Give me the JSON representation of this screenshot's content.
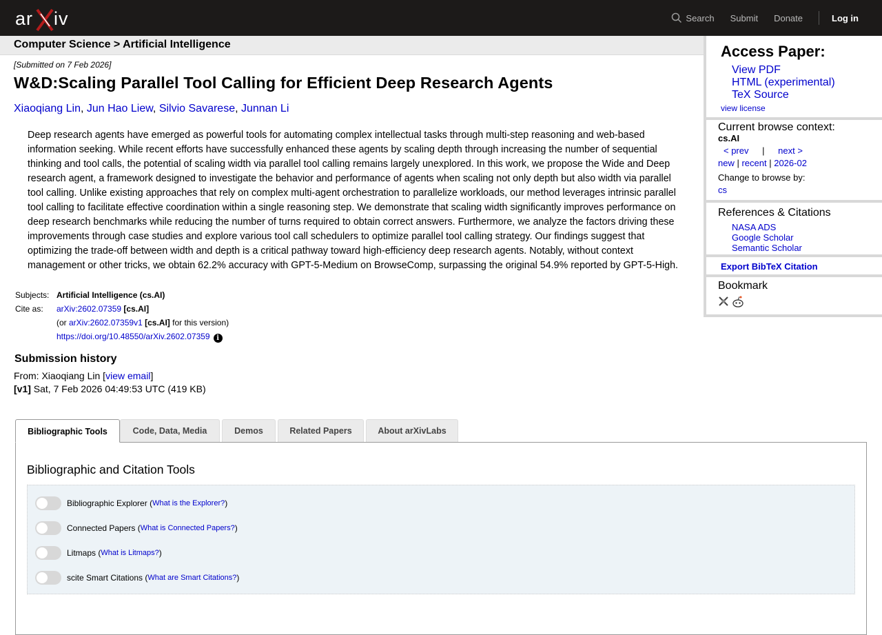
{
  "header": {
    "logo_text": "arXiv",
    "nav": {
      "search": "Search",
      "submit": "Submit",
      "donate": "Donate",
      "login": "Log in"
    },
    "colors": {
      "bg": "#1c1a19",
      "logo_x": "#b31b1b"
    }
  },
  "breadcrumb": "Computer Science > Artificial Intelligence",
  "paper": {
    "submitted": "[Submitted on 7 Feb 2026]",
    "title": "W&D:Scaling Parallel Tool Calling for Efficient Deep Research Agents",
    "authors": [
      "Xiaoqiang Lin",
      "Jun Hao Liew",
      "Silvio Savarese",
      "Junnan Li"
    ],
    "abstract": "Deep research agents have emerged as powerful tools for automating complex intellectual tasks through multi-step reasoning and web-based information seeking. While recent efforts have successfully enhanced these agents by scaling depth through increasing the number of sequential thinking and tool calls, the potential of scaling width via parallel tool calling remains largely unexplored. In this work, we propose the Wide and Deep research agent, a framework designed to investigate the behavior and performance of agents when scaling not only depth but also width via parallel tool calling. Unlike existing approaches that rely on complex multi-agent orchestration to parallelize workloads, our method leverages intrinsic parallel tool calling to facilitate effective coordination within a single reasoning step. We demonstrate that scaling width significantly improves performance on deep research benchmarks while reducing the number of turns required to obtain correct answers. Furthermore, we analyze the factors driving these improvements through case studies and explore various tool call schedulers to optimize parallel tool calling strategy. Our findings suggest that optimizing the trade-off between width and depth is a critical pathway toward high-efficiency deep research agents. Notably, without context management or other tricks, we obtain 62.2% accuracy with GPT-5-Medium on BrowseComp, surpassing the original 54.9% reported by GPT-5-High.",
    "subjects_label": "Subjects:",
    "subjects": "Artificial Intelligence (cs.AI)",
    "cite_label": "Cite as:",
    "cite_id": "arXiv:2602.07359",
    "cite_cat": "[cs.AI]",
    "cite_or": "(or ",
    "cite_v1": "arXiv:2602.07359v1",
    "cite_v1_cat": "[cs.AI]",
    "cite_suffix": " for this version)",
    "doi": "https://doi.org/10.48550/arXiv.2602.07359"
  },
  "history": {
    "heading": "Submission history",
    "from_prefix": "From: Xiaoqiang Lin [",
    "view_email": "view email",
    "from_suffix": "]",
    "version": "[v1]",
    "version_detail": " Sat, 7 Feb 2026 04:49:53 UTC (419 KB)"
  },
  "sidebar": {
    "access_heading": "Access Paper:",
    "access_links": [
      "View PDF",
      "HTML (experimental)",
      "TeX Source"
    ],
    "view_license": "view license",
    "context_heading": "Current browse context:",
    "context_cat": "cs.AI",
    "prev": "< prev",
    "divider": "|",
    "next": "next >",
    "new": "new",
    "recent": "recent",
    "month": "2026-02",
    "change_label": "Change to browse by:",
    "change_cat": "cs",
    "refs_heading": "References & Citations",
    "ref_links": [
      "NASA ADS",
      "Google Scholar",
      "Semantic Scholar"
    ],
    "bibtex": "Export BibTeX Citation",
    "bookmark_heading": "Bookmark",
    "bookmark_icons": [
      "bibsonomy-icon",
      "reddit-icon"
    ]
  },
  "tabs": [
    "Bibliographic Tools",
    "Code, Data, Media",
    "Demos",
    "Related Papers",
    "About arXivLabs"
  ],
  "tools": {
    "heading": "Bibliographic and Citation Tools",
    "rows": [
      {
        "label": "Bibliographic Explorer",
        "link": "What is the Explorer?"
      },
      {
        "label": "Connected Papers",
        "link": "What is Connected Papers?"
      },
      {
        "label": "Litmaps",
        "link": "What is Litmaps?"
      },
      {
        "label": "scite Smart Citations",
        "link": "What are Smart Citations?"
      }
    ]
  }
}
